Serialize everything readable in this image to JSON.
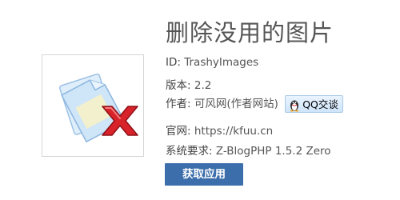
{
  "plugin": {
    "title": "删除没用的图片",
    "id_label": "ID:",
    "id_value": "TrashyImages",
    "version_label": "版本:",
    "version_value": "2.2",
    "author_label": "作者:",
    "author_value": "可风网(作者网站)",
    "qq_label": "QQ交谈",
    "site_label": "官网:",
    "site_value": "https://kfuu.cn",
    "req_label": "系统要求:",
    "req_value": "Z-BlogPHP 1.5.2 Zero",
    "get_button": "获取应用"
  },
  "icons": {
    "thumbnail": "trash-images-icon",
    "qq": "qq-penguin-icon"
  },
  "colors": {
    "button_bg": "#3c6eab",
    "delete_x": "#d8232a"
  }
}
